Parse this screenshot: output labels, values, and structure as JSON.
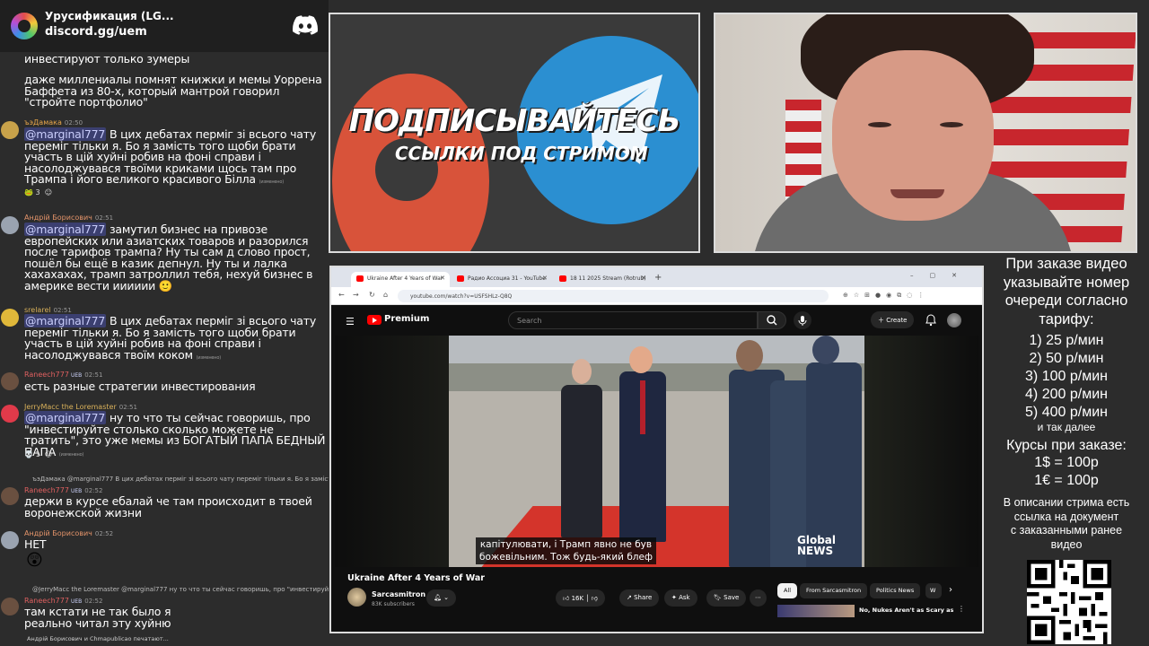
{
  "chat": {
    "server_title": "Урусификация (LG...",
    "server_invite": "discord.gg/uem",
    "messages": [
      {
        "body": "инвестируют только зумеры"
      },
      {
        "body": "даже миллениалы помнят книжки и мемы Уоррена Баффета из 80-х, который мантрой говорил \"стройте портфолио\""
      },
      {
        "user": "ъэДамака",
        "time": "02:50",
        "mention": "@marginal777",
        "body": " В цих дебатах перміг зі всього чату переміг тільки я. Бо я замість того щоби брати участь в цій хуйні робив на фоні справи і насолоджувався твоїми криками щось там про Трампа і його великого красивого Білла",
        "edited": "(изменено)",
        "reaction_count": "3"
      },
      {
        "user": "Андрій Борисович",
        "time": "02:51",
        "mention": "@marginal777",
        "body": " замутил бизнес на привозе европейских или азиатских товаров и разорился после тарифов трампа? Ну ты сам д слово прост, пошёл бы ещё в казик депнул. Ну ты и лалка хахахахах, трамп затроллил тебя, нехуй бизнес в америке вести ииииии"
      },
      {
        "user": "srelarel",
        "time": "02:51",
        "mention": "@marginal777",
        "body": " В цих дебатах перміг зі всього чату переміг тільки я. Бо я замість того щоби брати участь в цій хуйні робив на фоні справи і насолоджувався твоїм коком",
        "edited": "(изменено)"
      },
      {
        "user": "Raneech777",
        "time": "02:51",
        "tag": "UEB",
        "body": "есть разные стратегии инвестирования"
      },
      {
        "user": "JerryMacc the Loremaster",
        "time": "02:51",
        "mention": "@marginal777",
        "body": " ну то что ты сейчас говоришь, про \"инвестируйте столько сколько можете не тратить\", это уже мемы из БОГАТЫЙ ПАПА БЕДНЫЙ ПАПА",
        "edited": "(изменено)",
        "reaction_count": "1"
      },
      {
        "reply": "ъэДамака @marginal777 В цих дебатах перміг зі всього чату переміг тільки я. Бо я замість то",
        "user": "Raneech777",
        "time": "02:52",
        "tag": "UEB",
        "body": "держи в курсе ебалай че там происходит в твоей воронежской жизни"
      },
      {
        "user": "Андрій Борисович",
        "time": "02:52",
        "body": "НЕТ"
      },
      {
        "reply": "@JerryMacc the Loremaster @marginal777 ну то что ты сейчас говоришь, про \"инвестируйте сто...",
        "user": "Raneech777",
        "time": "02:52",
        "tag": "UEB",
        "body": "там кстати не так было я реально читал эту хуйню"
      }
    ],
    "typing": "Андрій Борисович и Chmapublicao печатают..."
  },
  "banner": {
    "title": "ПОДПИСЫВАЙТЕСЬ",
    "subtitle": "ССЫЛКИ ПОД СТРИМОМ"
  },
  "browser": {
    "tabs": [
      {
        "title": "Ukraine After 4 Years of War"
      },
      {
        "title": "Радио Ассоциа 31 - YouTube"
      },
      {
        "title": "18 11 2025 Stream (Rotrub)"
      }
    ],
    "url": "youtube.com/watch?v=USFSHLz-Q8Q",
    "youtube": {
      "brand": "Premium",
      "search_placeholder": "Search",
      "create_label": "Create",
      "subtitle_line1": "капітулювати, і Трамп явно не був",
      "subtitle_line2": "божевільним.  Тож будь-який блеф",
      "news_logo_line1": "Global",
      "news_logo_line2": "NEWS",
      "video_title": "Ukraine After 4 Years of War",
      "channel_name": "Sarcasmitron",
      "channel_subs": "83K subscribers",
      "likes": "16K",
      "share_label": "Share",
      "ask_label": "Ask",
      "save_label": "Save",
      "chips": [
        "All",
        "From Sarcasmitron",
        "Politics News",
        "W"
      ],
      "related_title": "No, Nukes Aren't as Scary as"
    }
  },
  "prices": {
    "heading": [
      "При заказе видео",
      "указывайте номер",
      "очереди согласно",
      "тарифу:"
    ],
    "items": [
      "1) 25 р/мин",
      "2) 50 р/мин",
      "3) 100 р/мин",
      "4) 200 р/мин",
      "5) 400 р/мин"
    ],
    "more": "и так далее",
    "rates_heading": "Курсы при заказе:",
    "rates": [
      "1$ = 100р",
      "1€ = 100р"
    ],
    "note": [
      "В описании стрима есть",
      "ссылка на документ",
      "с заказанными ранее",
      "видео"
    ]
  }
}
